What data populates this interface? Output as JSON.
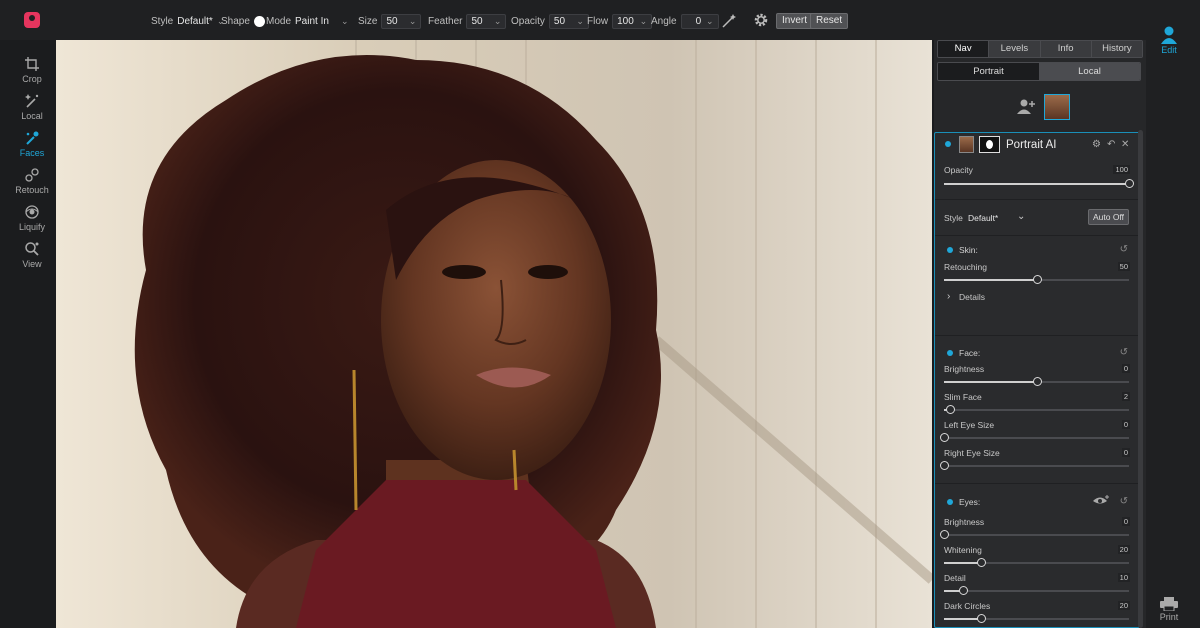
{
  "toolbar": {
    "style_label": "Style",
    "style_value": "Default*",
    "shape_label": "Shape",
    "mode_label": "Mode",
    "mode_value": "Paint In",
    "size_label": "Size",
    "size_value": "50",
    "feather_label": "Feather",
    "feather_value": "50",
    "opacity_label": "Opacity",
    "opacity_value": "50",
    "flow_label": "Flow",
    "flow_value": "100",
    "angle_label": "Angle",
    "angle_value": "0",
    "invert_label": "Invert",
    "reset_label": "Reset"
  },
  "left_tools": [
    {
      "label": "Crop",
      "icon": "crop-icon"
    },
    {
      "label": "Local",
      "icon": "local-brush-icon"
    },
    {
      "label": "Faces",
      "icon": "faces-icon",
      "active": true
    },
    {
      "label": "Retouch",
      "icon": "retouch-icon"
    },
    {
      "label": "Liquify",
      "icon": "liquify-icon"
    },
    {
      "label": "View",
      "icon": "view-zoom-icon"
    }
  ],
  "panel": {
    "tabs": [
      "Nav",
      "Levels",
      "Info",
      "History"
    ],
    "subtabs": [
      "Portrait",
      "Local"
    ],
    "layer": {
      "title": "Portrait AI",
      "opacity_label": "Opacity",
      "opacity_value": "100",
      "opacity_level": 1.0,
      "style_label": "Style",
      "style_value": "Default*",
      "auto_off_label": "Auto Off",
      "skin": {
        "label": "Skin:",
        "retouching_label": "Retouching",
        "retouching_value": "50",
        "retouching_level": 0.5,
        "details_label": "Details"
      },
      "face": {
        "label": "Face:",
        "sliders": [
          {
            "label": "Brightness",
            "value": "0",
            "level": 0.5
          },
          {
            "label": "Slim Face",
            "value": "2",
            "level": 0.03
          },
          {
            "label": "Left Eye Size",
            "value": "0",
            "level": 0.0
          },
          {
            "label": "Right Eye Size",
            "value": "0",
            "level": 0.0
          }
        ]
      },
      "eyes": {
        "label": "Eyes:",
        "sliders": [
          {
            "label": "Brightness",
            "value": "0",
            "level": 0.0
          },
          {
            "label": "Whitening",
            "value": "20",
            "level": 0.2
          },
          {
            "label": "Detail",
            "value": "10",
            "level": 0.1
          },
          {
            "label": "Dark Circles",
            "value": "20",
            "level": 0.2
          }
        ]
      }
    }
  },
  "right_tools": [
    {
      "label": "Edit",
      "icon": "edit-person-icon",
      "active": true
    },
    {
      "label": "Print",
      "icon": "print-icon"
    }
  ],
  "colors": {
    "accent": "#1fa7d8",
    "brand": "#e5355e"
  }
}
